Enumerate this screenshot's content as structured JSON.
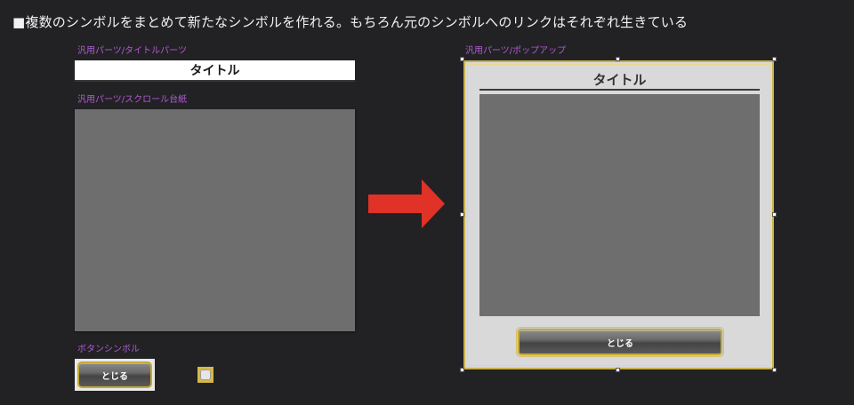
{
  "heading": "■複数のシンボルをまとめて新たなシンボルを作れる。もちろん元のシンボルへのリンクはそれぞれ生きている",
  "left": {
    "title_part_label": "汎用パーツ/タイトルパーツ",
    "title_text": "タイトル",
    "scroll_base_label": "汎用パーツ/スクロール台紙",
    "button_symbol_label": "ボタンシンボル",
    "button_text": "とじる"
  },
  "popup": {
    "label": "汎用パーツ/ポップアップ",
    "title_text": "タイトル",
    "close_text": "とじる"
  },
  "colors": {
    "background": "#222224",
    "label_purple": "#b05ad4",
    "arrow_red": "#e03226",
    "gold_border": "#c9b04a",
    "scroll_gray": "#6e6e6e"
  },
  "icons": {
    "arrow": "right-arrow-icon"
  }
}
